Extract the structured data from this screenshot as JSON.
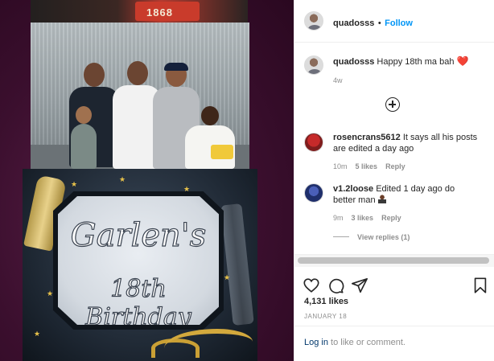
{
  "photo": {
    "top_strip_number": "1868",
    "sign_line1": "Garlen's",
    "sign_line2": "18th Birthday"
  },
  "header": {
    "username": "quadosss",
    "separator": "•",
    "follow_label": "Follow"
  },
  "caption": {
    "username": "quadosss",
    "text": "Happy 18th ma bah",
    "emoji": "❤️",
    "time": "4w"
  },
  "comments": [
    {
      "username": "rosencrans5612",
      "text": "It says all his posts are edited a day ago",
      "time": "10m",
      "likes": "5 likes",
      "reply": "Reply"
    },
    {
      "username": "v1.2loose",
      "text": "Edited 1 day ago do better man",
      "time": "9m",
      "likes": "3 likes",
      "reply": "Reply",
      "view_replies": "View replies (1)"
    }
  ],
  "footer": {
    "likes": "4,131 likes",
    "date": "JANUARY 18",
    "login_link": "Log in",
    "login_rest": "to like or comment."
  },
  "icons": [
    "heart-icon",
    "comment-icon",
    "share-icon",
    "bookmark-icon",
    "add-comment-icon"
  ]
}
